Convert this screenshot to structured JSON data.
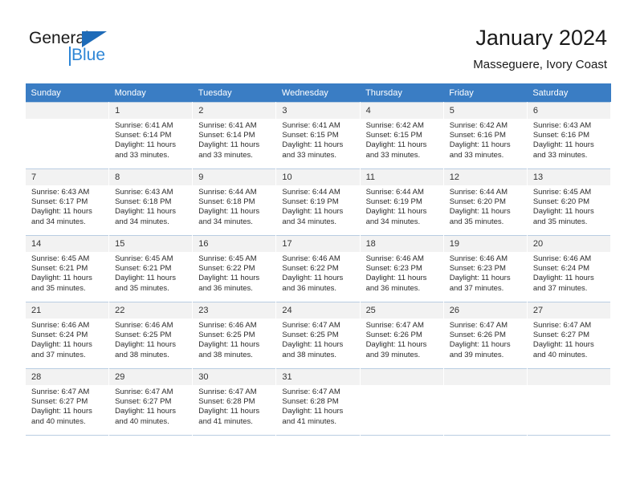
{
  "brand": {
    "name_part1": "General",
    "name_part2": "Blue",
    "triangle_color": "#1e6bb8",
    "blue_color": "#2e86d6"
  },
  "header": {
    "title": "January 2024",
    "subtitle": "Masseguere, Ivory Coast"
  },
  "calendar": {
    "header_bg": "#3a7dc4",
    "daynum_bg": "#f2f2f2",
    "row_border": "#b9cde2",
    "weekdays": [
      "Sunday",
      "Monday",
      "Tuesday",
      "Wednesday",
      "Thursday",
      "Friday",
      "Saturday"
    ],
    "weeks": [
      [
        {
          "day": "",
          "sunrise": "",
          "sunset": "",
          "daylight": "",
          "empty": true
        },
        {
          "day": "1",
          "sunrise": "Sunrise: 6:41 AM",
          "sunset": "Sunset: 6:14 PM",
          "daylight": "Daylight: 11 hours and 33 minutes."
        },
        {
          "day": "2",
          "sunrise": "Sunrise: 6:41 AM",
          "sunset": "Sunset: 6:14 PM",
          "daylight": "Daylight: 11 hours and 33 minutes."
        },
        {
          "day": "3",
          "sunrise": "Sunrise: 6:41 AM",
          "sunset": "Sunset: 6:15 PM",
          "daylight": "Daylight: 11 hours and 33 minutes."
        },
        {
          "day": "4",
          "sunrise": "Sunrise: 6:42 AM",
          "sunset": "Sunset: 6:15 PM",
          "daylight": "Daylight: 11 hours and 33 minutes."
        },
        {
          "day": "5",
          "sunrise": "Sunrise: 6:42 AM",
          "sunset": "Sunset: 6:16 PM",
          "daylight": "Daylight: 11 hours and 33 minutes."
        },
        {
          "day": "6",
          "sunrise": "Sunrise: 6:43 AM",
          "sunset": "Sunset: 6:16 PM",
          "daylight": "Daylight: 11 hours and 33 minutes."
        }
      ],
      [
        {
          "day": "7",
          "sunrise": "Sunrise: 6:43 AM",
          "sunset": "Sunset: 6:17 PM",
          "daylight": "Daylight: 11 hours and 34 minutes."
        },
        {
          "day": "8",
          "sunrise": "Sunrise: 6:43 AM",
          "sunset": "Sunset: 6:18 PM",
          "daylight": "Daylight: 11 hours and 34 minutes."
        },
        {
          "day": "9",
          "sunrise": "Sunrise: 6:44 AM",
          "sunset": "Sunset: 6:18 PM",
          "daylight": "Daylight: 11 hours and 34 minutes."
        },
        {
          "day": "10",
          "sunrise": "Sunrise: 6:44 AM",
          "sunset": "Sunset: 6:19 PM",
          "daylight": "Daylight: 11 hours and 34 minutes."
        },
        {
          "day": "11",
          "sunrise": "Sunrise: 6:44 AM",
          "sunset": "Sunset: 6:19 PM",
          "daylight": "Daylight: 11 hours and 34 minutes."
        },
        {
          "day": "12",
          "sunrise": "Sunrise: 6:44 AM",
          "sunset": "Sunset: 6:20 PM",
          "daylight": "Daylight: 11 hours and 35 minutes."
        },
        {
          "day": "13",
          "sunrise": "Sunrise: 6:45 AM",
          "sunset": "Sunset: 6:20 PM",
          "daylight": "Daylight: 11 hours and 35 minutes."
        }
      ],
      [
        {
          "day": "14",
          "sunrise": "Sunrise: 6:45 AM",
          "sunset": "Sunset: 6:21 PM",
          "daylight": "Daylight: 11 hours and 35 minutes."
        },
        {
          "day": "15",
          "sunrise": "Sunrise: 6:45 AM",
          "sunset": "Sunset: 6:21 PM",
          "daylight": "Daylight: 11 hours and 35 minutes."
        },
        {
          "day": "16",
          "sunrise": "Sunrise: 6:45 AM",
          "sunset": "Sunset: 6:22 PM",
          "daylight": "Daylight: 11 hours and 36 minutes."
        },
        {
          "day": "17",
          "sunrise": "Sunrise: 6:46 AM",
          "sunset": "Sunset: 6:22 PM",
          "daylight": "Daylight: 11 hours and 36 minutes."
        },
        {
          "day": "18",
          "sunrise": "Sunrise: 6:46 AM",
          "sunset": "Sunset: 6:23 PM",
          "daylight": "Daylight: 11 hours and 36 minutes."
        },
        {
          "day": "19",
          "sunrise": "Sunrise: 6:46 AM",
          "sunset": "Sunset: 6:23 PM",
          "daylight": "Daylight: 11 hours and 37 minutes."
        },
        {
          "day": "20",
          "sunrise": "Sunrise: 6:46 AM",
          "sunset": "Sunset: 6:24 PM",
          "daylight": "Daylight: 11 hours and 37 minutes."
        }
      ],
      [
        {
          "day": "21",
          "sunrise": "Sunrise: 6:46 AM",
          "sunset": "Sunset: 6:24 PM",
          "daylight": "Daylight: 11 hours and 37 minutes."
        },
        {
          "day": "22",
          "sunrise": "Sunrise: 6:46 AM",
          "sunset": "Sunset: 6:25 PM",
          "daylight": "Daylight: 11 hours and 38 minutes."
        },
        {
          "day": "23",
          "sunrise": "Sunrise: 6:46 AM",
          "sunset": "Sunset: 6:25 PM",
          "daylight": "Daylight: 11 hours and 38 minutes."
        },
        {
          "day": "24",
          "sunrise": "Sunrise: 6:47 AM",
          "sunset": "Sunset: 6:25 PM",
          "daylight": "Daylight: 11 hours and 38 minutes."
        },
        {
          "day": "25",
          "sunrise": "Sunrise: 6:47 AM",
          "sunset": "Sunset: 6:26 PM",
          "daylight": "Daylight: 11 hours and 39 minutes."
        },
        {
          "day": "26",
          "sunrise": "Sunrise: 6:47 AM",
          "sunset": "Sunset: 6:26 PM",
          "daylight": "Daylight: 11 hours and 39 minutes."
        },
        {
          "day": "27",
          "sunrise": "Sunrise: 6:47 AM",
          "sunset": "Sunset: 6:27 PM",
          "daylight": "Daylight: 11 hours and 40 minutes."
        }
      ],
      [
        {
          "day": "28",
          "sunrise": "Sunrise: 6:47 AM",
          "sunset": "Sunset: 6:27 PM",
          "daylight": "Daylight: 11 hours and 40 minutes."
        },
        {
          "day": "29",
          "sunrise": "Sunrise: 6:47 AM",
          "sunset": "Sunset: 6:27 PM",
          "daylight": "Daylight: 11 hours and 40 minutes."
        },
        {
          "day": "30",
          "sunrise": "Sunrise: 6:47 AM",
          "sunset": "Sunset: 6:28 PM",
          "daylight": "Daylight: 11 hours and 41 minutes."
        },
        {
          "day": "31",
          "sunrise": "Sunrise: 6:47 AM",
          "sunset": "Sunset: 6:28 PM",
          "daylight": "Daylight: 11 hours and 41 minutes."
        },
        {
          "day": "",
          "sunrise": "",
          "sunset": "",
          "daylight": "",
          "empty": true
        },
        {
          "day": "",
          "sunrise": "",
          "sunset": "",
          "daylight": "",
          "empty": true
        },
        {
          "day": "",
          "sunrise": "",
          "sunset": "",
          "daylight": "",
          "empty": true
        }
      ]
    ]
  }
}
